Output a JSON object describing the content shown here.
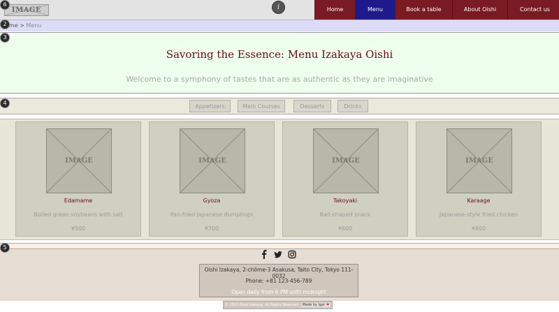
{
  "header": {
    "logo_text": "IMAGE",
    "info_glyph": "i",
    "nav": [
      {
        "label": "Home",
        "active": false
      },
      {
        "label": "Menu",
        "active": true
      },
      {
        "label": "Book a table",
        "active": false
      },
      {
        "label": "About Oishi",
        "active": false
      },
      {
        "label": "Contact us",
        "active": false
      }
    ]
  },
  "breadcrumb": {
    "home": "Home",
    "separator": ">",
    "current": "Menu"
  },
  "hero": {
    "title": "Savoring the Essence: Menu Izakaya Oishi",
    "subtitle": "Welcome to a symphony of tastes that are as authentic as they are imaginative"
  },
  "tabs": [
    "Appetizers",
    "Main Courses",
    "Desserts",
    "Drinks"
  ],
  "menu_items": [
    {
      "image_label": "IMAGE",
      "name": "Edamame",
      "description": "Boiled green soybeans with salt",
      "price": "¥500"
    },
    {
      "image_label": "IMAGE",
      "name": "Gyoza",
      "description": "Pan-fried Japanese dumplings",
      "price": "¥700"
    },
    {
      "image_label": "IMAGE",
      "name": "Takoyaki",
      "description": "Ball-shaped snack",
      "price": "¥600"
    },
    {
      "image_label": "IMAGE",
      "name": "Karaage",
      "description": "Japanese-style fried chicken",
      "price": "¥800"
    }
  ],
  "footer": {
    "social_icons": [
      "facebook-icon",
      "twitter-icon",
      "instagram-icon"
    ],
    "address": "Oishi Izakaya, 2-chōme-3 Asakusa, Taito City, Tokyo 111-0032",
    "phone": "Phone: +81 123-456-789",
    "hours": "Open daily from 6 PM until midnight",
    "copyright": "© 2023 Oishi Izakaya. All Rights Reserved.",
    "made_by": "Made by Igor",
    "heart": "❤"
  },
  "section_markers": [
    "6",
    "2",
    "3",
    "4",
    "5"
  ],
  "colors": {
    "nav_bg": "#7a1a22",
    "nav_active": "#1e1a8c",
    "accent_text": "#6a0c15",
    "hero_bg": "#eeffee",
    "footer_bg": "#e8ddd4"
  }
}
